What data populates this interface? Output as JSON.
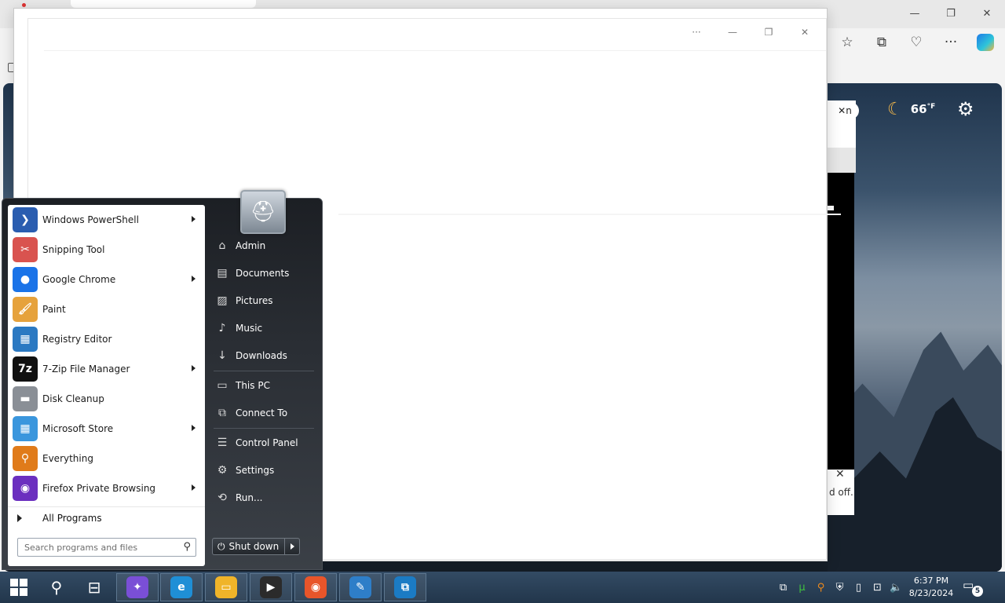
{
  "browser": {
    "window_controls": [
      "—",
      "❐",
      "✕"
    ],
    "toolbar_icons": [
      "favorites-star-icon",
      "collections-icon",
      "browser-essentials-icon",
      "more-icon",
      "copilot-icon"
    ]
  },
  "newtab": {
    "weather_temp": "66",
    "weather_unit": "°F",
    "chip_text": "n"
  },
  "hidden_panel": {
    "toast_text": "d off."
  },
  "app_window": {
    "controls": [
      "···",
      "—",
      "❐",
      "✕"
    ]
  },
  "start_menu": {
    "programs": [
      {
        "label": "Windows PowerShell",
        "icon": "powershell-icon",
        "color": "#2a5db0",
        "glyph": "❯",
        "submenu": true
      },
      {
        "label": "Snipping Tool",
        "icon": "snipping-tool-icon",
        "color": "#d9534f",
        "glyph": "✂",
        "submenu": false
      },
      {
        "label": "Google Chrome",
        "icon": "chrome-icon",
        "color": "#1a73e8",
        "glyph": "●",
        "submenu": true
      },
      {
        "label": "Paint",
        "icon": "paint-icon",
        "color": "#e6a23c",
        "glyph": "🖌",
        "submenu": false
      },
      {
        "label": "Registry Editor",
        "icon": "registry-editor-icon",
        "color": "#2b79c2",
        "glyph": "▦",
        "submenu": false
      },
      {
        "label": "7-Zip File Manager",
        "icon": "7zip-icon",
        "color": "#111111",
        "glyph": "7z",
        "submenu": true
      },
      {
        "label": "Disk Cleanup",
        "icon": "disk-cleanup-icon",
        "color": "#8a8f96",
        "glyph": "▬",
        "submenu": false
      },
      {
        "label": "Microsoft Store",
        "icon": "microsoft-store-icon",
        "color": "#3a96dd",
        "glyph": "▦",
        "submenu": true
      },
      {
        "label": "Everything",
        "icon": "everything-search-icon",
        "color": "#e07b1a",
        "glyph": "⚲",
        "submenu": false
      },
      {
        "label": "Firefox Private Browsing",
        "icon": "firefox-private-icon",
        "color": "#6b2fbf",
        "glyph": "◉",
        "submenu": true
      }
    ],
    "all_programs": "All Programs",
    "search_placeholder": "Search programs and files",
    "places": [
      {
        "label": "Admin",
        "icon": "user-folder-icon",
        "glyph": "⌂",
        "sep_after": false
      },
      {
        "label": "Documents",
        "icon": "documents-icon",
        "glyph": "▤",
        "sep_after": false
      },
      {
        "label": "Pictures",
        "icon": "pictures-icon",
        "glyph": "▨",
        "sep_after": false
      },
      {
        "label": "Music",
        "icon": "music-icon",
        "glyph": "♪",
        "sep_after": false
      },
      {
        "label": "Downloads",
        "icon": "downloads-icon",
        "glyph": "↓",
        "sep_after": true
      },
      {
        "label": "This PC",
        "icon": "this-pc-icon",
        "glyph": "▭",
        "sep_after": false
      },
      {
        "label": "Connect To",
        "icon": "connect-to-icon",
        "glyph": "⧉",
        "sep_after": true
      },
      {
        "label": "Control Panel",
        "icon": "control-panel-icon",
        "glyph": "☰",
        "sep_after": false
      },
      {
        "label": "Settings",
        "icon": "settings-icon",
        "glyph": "⚙",
        "sep_after": false
      },
      {
        "label": "Run...",
        "icon": "run-icon",
        "glyph": "⟲",
        "sep_after": false
      }
    ],
    "shutdown_label": "Shut down"
  },
  "taskbar": {
    "apps": [
      {
        "name": "copilot-app",
        "color": "#7a4fd6",
        "glyph": "✦"
      },
      {
        "name": "edge-app",
        "color": "#1f8fd6",
        "glyph": "e"
      },
      {
        "name": "file-explorer-app",
        "color": "#f0b429",
        "glyph": "▭"
      },
      {
        "name": "media-player-app",
        "color": "#2b2b2b",
        "glyph": "▶"
      },
      {
        "name": "firefox-app",
        "color": "#e8552a",
        "glyph": "◉"
      },
      {
        "name": "paint-app",
        "color": "#2e7ec8",
        "glyph": "✎"
      },
      {
        "name": "remote-desktop-app",
        "color": "#1b7bc4",
        "glyph": "⧉"
      }
    ],
    "time": "6:37 PM",
    "date": "8/23/2024",
    "notification_count": "5"
  }
}
